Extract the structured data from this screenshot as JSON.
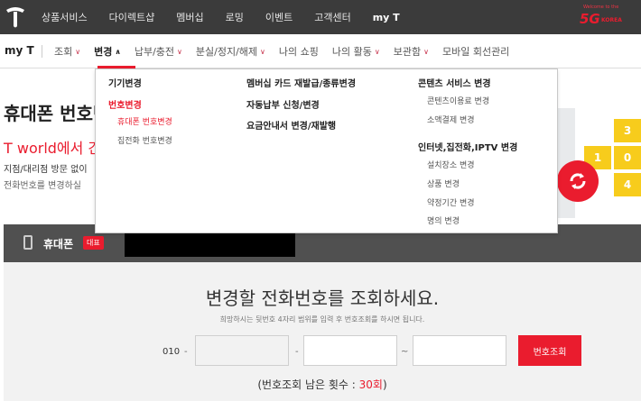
{
  "topnav": {
    "items": [
      "상품서비스",
      "다이렉트샵",
      "멤버십",
      "로밍",
      "이벤트",
      "고객센터",
      "my T"
    ],
    "active_index": 6,
    "banner_small": "Welcome to the",
    "banner_big": "5G",
    "banner_korea": "KOREA"
  },
  "subnav": {
    "title": "my T",
    "items": [
      {
        "label": "조회",
        "chevron": "down"
      },
      {
        "label": "변경",
        "chevron": "up"
      },
      {
        "label": "납부/충전",
        "chevron": "down"
      },
      {
        "label": "분실/정지/해제",
        "chevron": "down"
      },
      {
        "label": "나의 쇼핑",
        "chevron": ""
      },
      {
        "label": "나의 활동",
        "chevron": "down"
      },
      {
        "label": "보관함",
        "chevron": "down"
      },
      {
        "label": "모바일 회선관리",
        "chevron": ""
      }
    ],
    "active_index": 1
  },
  "dropdown": {
    "col1": {
      "heading1": "기기변경",
      "heading2": "번호변경",
      "sub1": "휴대폰 번호변경",
      "sub2": "집전화 번호변경"
    },
    "col2": {
      "heading1": "멤버십 카드 재발급/종류변경",
      "heading2": "자동납부 신청/변경",
      "heading3": "요금안내서 변경/재발행"
    },
    "col3": {
      "heading1": "콘텐츠 서비스 변경",
      "sub1": "콘텐츠이용료 변경",
      "sub2": "소액결제 변경",
      "heading2": "인터넷,집전화,IPTV 변경",
      "sub3": "설치장소 변경",
      "sub4": "상품 변경",
      "sub5": "약정기간 변경",
      "sub6": "명의 변경"
    }
  },
  "page": {
    "heading": "휴대폰 번호변경",
    "red_tagline": "T world에서 간",
    "desc1": "지점/대리점 방문 없이",
    "desc2": "전화번호를 변경하실"
  },
  "keypad": [
    "3",
    "1",
    "0",
    "4"
  ],
  "phone_bar": {
    "label": "휴대폰",
    "badge": "대표"
  },
  "lookup": {
    "title": "변경할 전화번호를 조회하세요.",
    "hint": "희망하시는 뒷번호 4자리 범위를 입력 후 번호조회를 하시면 됩니다.",
    "prefix": "010",
    "dash": "-",
    "tilde": "~",
    "button": "번호조회",
    "remain_prefix": "(번호조회 남은 횟수 : ",
    "remain_count": "30회",
    "remain_suffix": ")"
  },
  "colors": {
    "brand_red": "#ea1c2e",
    "topbar": "#3b3b3b",
    "phonebar": "#505050",
    "keypad_yellow": "#f7cc1c"
  }
}
